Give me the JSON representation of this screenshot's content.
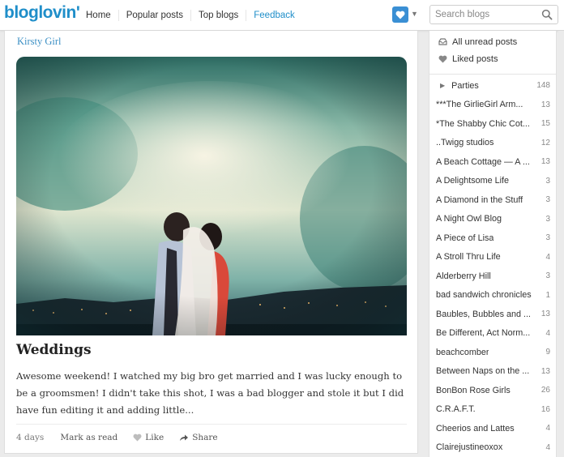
{
  "app": {
    "logo": "bloglovin'"
  },
  "nav": {
    "items": [
      {
        "label": "Home"
      },
      {
        "label": "Popular posts"
      },
      {
        "label": "Top blogs"
      },
      {
        "label": "Feedback"
      }
    ]
  },
  "search": {
    "placeholder": "Search blogs"
  },
  "post": {
    "blog_name": "Kirsty Girl",
    "title": "Weddings",
    "excerpt": "Awesome weekend! I watched my big bro get married and I was lucky enough to be a groomsmen! I didn't take this shot, I was a bad blogger and stole it but I did have fun editing it and adding little...",
    "age": "4 days",
    "mark_read": "Mark as read",
    "like": "Like",
    "share": "Share"
  },
  "sidebar": {
    "all_unread": "All unread posts",
    "liked": "Liked posts",
    "folder": {
      "name": "Parties",
      "count": "148"
    },
    "blogs": [
      {
        "name": "***The GirlieGirl Arm...",
        "count": "13"
      },
      {
        "name": "*The Shabby Chic Cot...",
        "count": "15"
      },
      {
        "name": "..Twigg studios",
        "count": "12"
      },
      {
        "name": "A Beach Cottage — A ...",
        "count": "13"
      },
      {
        "name": "A Delightsome Life",
        "count": "3"
      },
      {
        "name": "A Diamond in the Stuff",
        "count": "3"
      },
      {
        "name": "A Night Owl Blog",
        "count": "3"
      },
      {
        "name": "A Piece of Lisa",
        "count": "3"
      },
      {
        "name": "A Stroll Thru Life",
        "count": "4"
      },
      {
        "name": "Alderberry Hill",
        "count": "3"
      },
      {
        "name": "bad sandwich chronicles",
        "count": "1"
      },
      {
        "name": "Baubles, Bubbles and ...",
        "count": "13"
      },
      {
        "name": "Be Different, Act Norm...",
        "count": "4"
      },
      {
        "name": "beachcomber",
        "count": "9"
      },
      {
        "name": "Between Naps on the ...",
        "count": "13"
      },
      {
        "name": "BonBon Rose Girls",
        "count": "26"
      },
      {
        "name": "C.R.A.F.T.",
        "count": "16"
      },
      {
        "name": "Cheerios and Lattes",
        "count": "4"
      },
      {
        "name": "Clairejustineoxox",
        "count": "4"
      }
    ]
  },
  "colors": {
    "brand": "#1f8ec9",
    "heart_button": "#3a8fd4"
  }
}
